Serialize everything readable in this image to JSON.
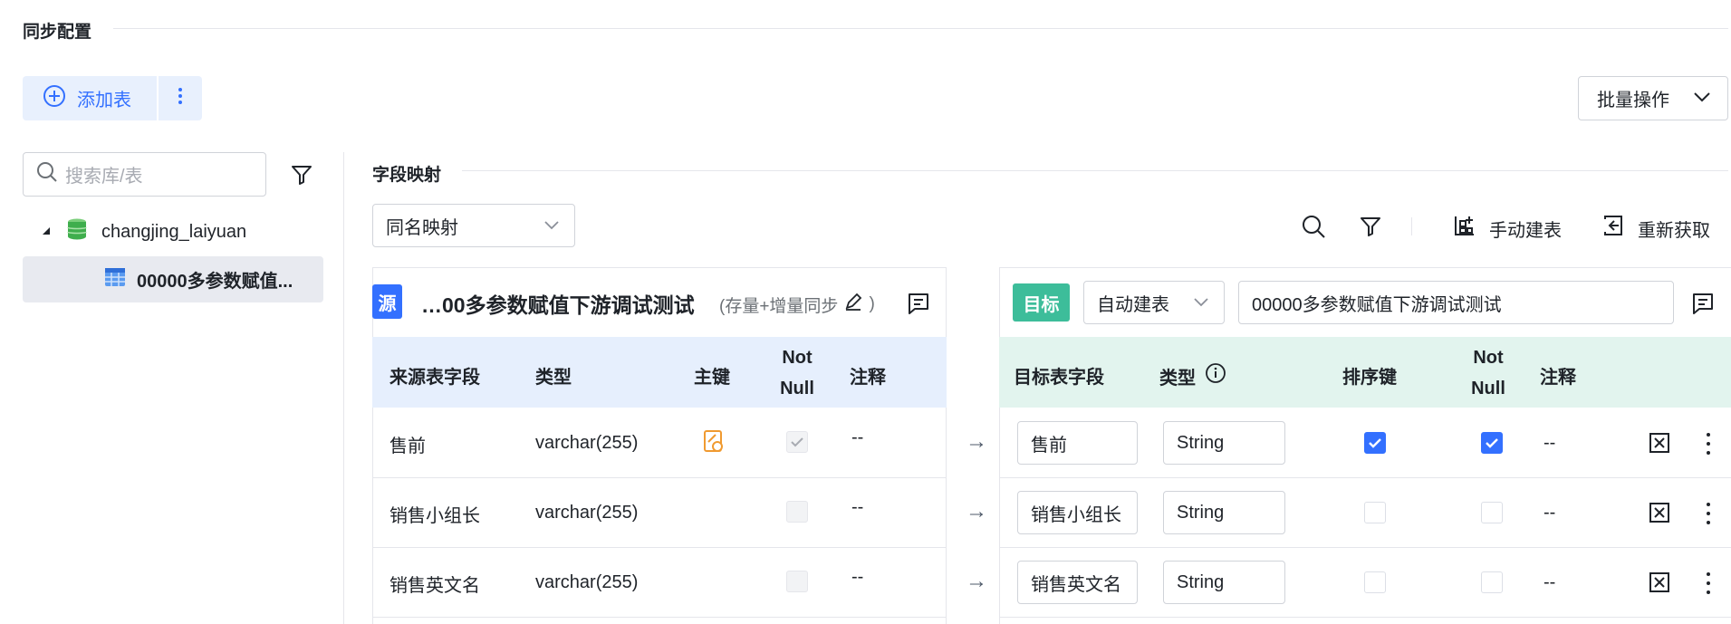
{
  "section": {
    "title": "同步配置"
  },
  "toolbar": {
    "add_table_label": "添加表",
    "batch_label": "批量操作"
  },
  "sidebar": {
    "search_placeholder": "搜索库/表",
    "tree": [
      {
        "label": "changjing_laiyuan"
      },
      {
        "label": "00000多参数赋值..."
      }
    ]
  },
  "mapping": {
    "title": "字段映射",
    "mode_select": "同名映射",
    "manual_create_label": "手动建表",
    "refetch_label": "重新获取"
  },
  "source": {
    "tag": "源",
    "table_name": "…00多参数赋值下游调试测试",
    "sync_mode": "(存量+增量同步",
    "close_paren": ")",
    "headers": {
      "field": "来源表字段",
      "type": "类型",
      "pk": "主键",
      "notnull_1": "Not",
      "notnull_2": "Null",
      "comment": "注释"
    },
    "rows": [
      {
        "field": "售前",
        "type": "varchar(255)",
        "comment": "--"
      },
      {
        "field": "销售小组长",
        "type": "varchar(255)",
        "comment": "--"
      },
      {
        "field": "销售英文名",
        "type": "varchar(255)",
        "comment": "--"
      }
    ]
  },
  "target": {
    "tag": "目标",
    "create_mode": "自动建表",
    "table_name": "00000多参数赋值下游调试测试",
    "headers": {
      "field": "目标表字段",
      "type": "类型",
      "sort_key": "排序键",
      "notnull_1": "Not",
      "notnull_2": "Null",
      "comment": "注释"
    },
    "rows": [
      {
        "field": "售前",
        "type": "String",
        "comment": "--"
      },
      {
        "field": "销售小组长",
        "type": "String",
        "comment": "--"
      },
      {
        "field": "销售英文名",
        "type": "String",
        "comment": "--"
      }
    ]
  },
  "arrow": "→"
}
